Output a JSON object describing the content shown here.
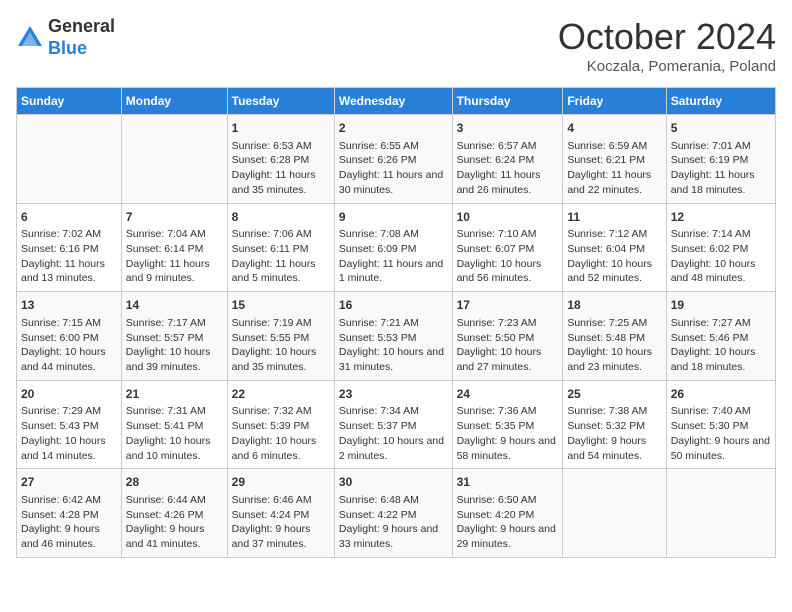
{
  "header": {
    "logo_general": "General",
    "logo_blue": "Blue",
    "month_title": "October 2024",
    "location": "Koczala, Pomerania, Poland"
  },
  "weekdays": [
    "Sunday",
    "Monday",
    "Tuesday",
    "Wednesday",
    "Thursday",
    "Friday",
    "Saturday"
  ],
  "rows": [
    [
      {
        "day": "",
        "content": ""
      },
      {
        "day": "",
        "content": ""
      },
      {
        "day": "1",
        "content": "Sunrise: 6:53 AM\nSunset: 6:28 PM\nDaylight: 11 hours and 35 minutes."
      },
      {
        "day": "2",
        "content": "Sunrise: 6:55 AM\nSunset: 6:26 PM\nDaylight: 11 hours and 30 minutes."
      },
      {
        "day": "3",
        "content": "Sunrise: 6:57 AM\nSunset: 6:24 PM\nDaylight: 11 hours and 26 minutes."
      },
      {
        "day": "4",
        "content": "Sunrise: 6:59 AM\nSunset: 6:21 PM\nDaylight: 11 hours and 22 minutes."
      },
      {
        "day": "5",
        "content": "Sunrise: 7:01 AM\nSunset: 6:19 PM\nDaylight: 11 hours and 18 minutes."
      }
    ],
    [
      {
        "day": "6",
        "content": "Sunrise: 7:02 AM\nSunset: 6:16 PM\nDaylight: 11 hours and 13 minutes."
      },
      {
        "day": "7",
        "content": "Sunrise: 7:04 AM\nSunset: 6:14 PM\nDaylight: 11 hours and 9 minutes."
      },
      {
        "day": "8",
        "content": "Sunrise: 7:06 AM\nSunset: 6:11 PM\nDaylight: 11 hours and 5 minutes."
      },
      {
        "day": "9",
        "content": "Sunrise: 7:08 AM\nSunset: 6:09 PM\nDaylight: 11 hours and 1 minute."
      },
      {
        "day": "10",
        "content": "Sunrise: 7:10 AM\nSunset: 6:07 PM\nDaylight: 10 hours and 56 minutes."
      },
      {
        "day": "11",
        "content": "Sunrise: 7:12 AM\nSunset: 6:04 PM\nDaylight: 10 hours and 52 minutes."
      },
      {
        "day": "12",
        "content": "Sunrise: 7:14 AM\nSunset: 6:02 PM\nDaylight: 10 hours and 48 minutes."
      }
    ],
    [
      {
        "day": "13",
        "content": "Sunrise: 7:15 AM\nSunset: 6:00 PM\nDaylight: 10 hours and 44 minutes."
      },
      {
        "day": "14",
        "content": "Sunrise: 7:17 AM\nSunset: 5:57 PM\nDaylight: 10 hours and 39 minutes."
      },
      {
        "day": "15",
        "content": "Sunrise: 7:19 AM\nSunset: 5:55 PM\nDaylight: 10 hours and 35 minutes."
      },
      {
        "day": "16",
        "content": "Sunrise: 7:21 AM\nSunset: 5:53 PM\nDaylight: 10 hours and 31 minutes."
      },
      {
        "day": "17",
        "content": "Sunrise: 7:23 AM\nSunset: 5:50 PM\nDaylight: 10 hours and 27 minutes."
      },
      {
        "day": "18",
        "content": "Sunrise: 7:25 AM\nSunset: 5:48 PM\nDaylight: 10 hours and 23 minutes."
      },
      {
        "day": "19",
        "content": "Sunrise: 7:27 AM\nSunset: 5:46 PM\nDaylight: 10 hours and 18 minutes."
      }
    ],
    [
      {
        "day": "20",
        "content": "Sunrise: 7:29 AM\nSunset: 5:43 PM\nDaylight: 10 hours and 14 minutes."
      },
      {
        "day": "21",
        "content": "Sunrise: 7:31 AM\nSunset: 5:41 PM\nDaylight: 10 hours and 10 minutes."
      },
      {
        "day": "22",
        "content": "Sunrise: 7:32 AM\nSunset: 5:39 PM\nDaylight: 10 hours and 6 minutes."
      },
      {
        "day": "23",
        "content": "Sunrise: 7:34 AM\nSunset: 5:37 PM\nDaylight: 10 hours and 2 minutes."
      },
      {
        "day": "24",
        "content": "Sunrise: 7:36 AM\nSunset: 5:35 PM\nDaylight: 9 hours and 58 minutes."
      },
      {
        "day": "25",
        "content": "Sunrise: 7:38 AM\nSunset: 5:32 PM\nDaylight: 9 hours and 54 minutes."
      },
      {
        "day": "26",
        "content": "Sunrise: 7:40 AM\nSunset: 5:30 PM\nDaylight: 9 hours and 50 minutes."
      }
    ],
    [
      {
        "day": "27",
        "content": "Sunrise: 6:42 AM\nSunset: 4:28 PM\nDaylight: 9 hours and 46 minutes."
      },
      {
        "day": "28",
        "content": "Sunrise: 6:44 AM\nSunset: 4:26 PM\nDaylight: 9 hours and 41 minutes."
      },
      {
        "day": "29",
        "content": "Sunrise: 6:46 AM\nSunset: 4:24 PM\nDaylight: 9 hours and 37 minutes."
      },
      {
        "day": "30",
        "content": "Sunrise: 6:48 AM\nSunset: 4:22 PM\nDaylight: 9 hours and 33 minutes."
      },
      {
        "day": "31",
        "content": "Sunrise: 6:50 AM\nSunset: 4:20 PM\nDaylight: 9 hours and 29 minutes."
      },
      {
        "day": "",
        "content": ""
      },
      {
        "day": "",
        "content": ""
      }
    ]
  ]
}
